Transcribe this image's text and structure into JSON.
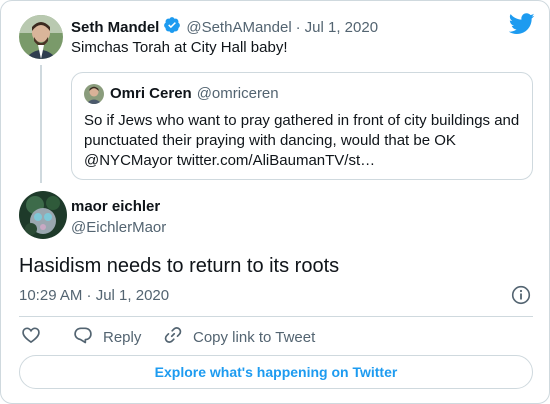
{
  "parent_tweet": {
    "author_name": "Seth Mandel",
    "handle": "@SethAMandel",
    "separator": "·",
    "date": "Jul 1, 2020",
    "text": "Simchas Torah at City Hall baby!",
    "quoted_tweet": {
      "author_name": "Omri Ceren",
      "handle": "@omriceren",
      "text": "So if Jews who want to pray gathered in front of city buildings and punctuated their praying with dancing, would that be OK @NYCMayor twitter.com/AliBaumanTV/st…"
    }
  },
  "tweet": {
    "author_name": "maor eichler",
    "handle": "@EichlerMaor",
    "text": "Hasidism needs to return to its roots",
    "timestamp": "10:29 AM · Jul 1, 2020"
  },
  "actions": {
    "reply_label": "Reply",
    "copy_link_label": "Copy link to Tweet"
  },
  "explore_label": "Explore what's happening on Twitter",
  "colors": {
    "brand_blue": "#1d9bf0",
    "muted_text": "#536471",
    "border": "#cfd9de"
  }
}
